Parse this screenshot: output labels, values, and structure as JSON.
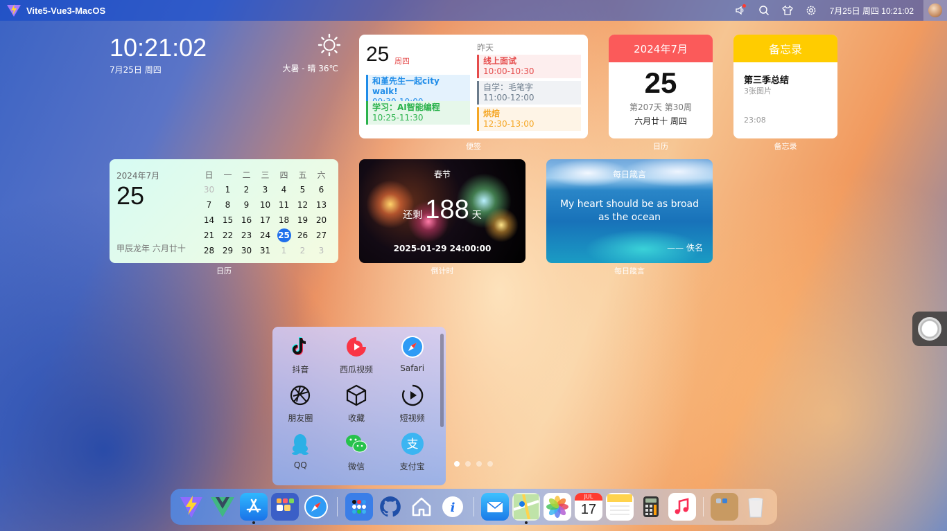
{
  "menubar": {
    "app_title": "Vite5-Vue3-MacOS",
    "datetime": "7月25日 周四 10:21:02",
    "icons": [
      "speaker-icon",
      "search-icon",
      "shirt-icon",
      "settings-icon",
      "avatar"
    ]
  },
  "clock": {
    "time": "10:21:02",
    "date": "7月25日 周四",
    "weather": "大暑 - 晴 36℃"
  },
  "notes": {
    "day": "25",
    "weekday": "周四",
    "yesterday_label": "昨天",
    "today_events": [
      {
        "title": "和堇先生一起city walk!",
        "time": "09:30-10:00",
        "color": "#1f8ce8"
      },
      {
        "title": "学习：AI智能编程",
        "time": "10:25-11:30",
        "color": "#2bb24c"
      }
    ],
    "yesterday_events": [
      {
        "title": "线上面试",
        "time": "10:00-10:30",
        "color": "#e54b4b"
      },
      {
        "title": "自学：毛笔字",
        "time": "11:00-12:00",
        "color": "#6b7b8b"
      },
      {
        "title": "烘焙",
        "time": "12:30-13:00",
        "color": "#f5a623"
      }
    ],
    "caption": "便签"
  },
  "calendar_card": {
    "header": "2024年7月",
    "day": "25",
    "sub": "第207天 第30周",
    "lunar": "六月廿十 周四",
    "caption": "日历"
  },
  "memo": {
    "header": "备忘录",
    "title": "第三季总结",
    "sub": "3张图片",
    "time": "23:08",
    "caption": "备忘录"
  },
  "month_calendar": {
    "year_month": "2024年7月",
    "day": "25",
    "lunar": "甲辰龙年 六月廿十",
    "weekdays": [
      "日",
      "一",
      "二",
      "三",
      "四",
      "五",
      "六"
    ],
    "days": [
      "30",
      "1",
      "2",
      "3",
      "4",
      "5",
      "6",
      "7",
      "8",
      "9",
      "10",
      "11",
      "12",
      "13",
      "14",
      "15",
      "16",
      "17",
      "18",
      "19",
      "20",
      "21",
      "22",
      "23",
      "24",
      "25",
      "26",
      "27",
      "28",
      "29",
      "30",
      "31",
      "1",
      "2",
      "3"
    ],
    "dim_indices": [
      0,
      32,
      33,
      34
    ],
    "today_index": 25,
    "caption": "日历"
  },
  "countdown": {
    "title": "春节",
    "remain_label": "还剩",
    "days": "188",
    "unit": "天",
    "target": "2025-01-29 24:00:00",
    "caption": "倒计时"
  },
  "quote": {
    "title": "每日箴言",
    "text": "My heart should be as broad as the ocean",
    "author": "—— 佚名",
    "caption": "每日箴言"
  },
  "folder": {
    "apps": [
      {
        "label": "抖音",
        "icon": "douyin-icon"
      },
      {
        "label": "西瓜视频",
        "icon": "xigua-icon"
      },
      {
        "label": "Safari",
        "icon": "safari-icon"
      },
      {
        "label": "朋友圈",
        "icon": "moments-icon"
      },
      {
        "label": "收藏",
        "icon": "cube-icon"
      },
      {
        "label": "短视频",
        "icon": "play-circle-icon"
      },
      {
        "label": "QQ",
        "icon": "qq-icon"
      },
      {
        "label": "微信",
        "icon": "wechat-icon"
      },
      {
        "label": "支付宝",
        "icon": "alipay-icon"
      }
    ],
    "page_count": 4,
    "active_page": 1
  },
  "dock": {
    "items": [
      "vite-icon",
      "vue-icon",
      "app-store-icon",
      "launchpad-icon",
      "safari-icon",
      "app-folder-icon",
      "github-icon",
      "home-icon",
      "info-icon",
      "mail-icon",
      "maps-icon",
      "photos-icon",
      "calendar-icon",
      "notes-icon",
      "calculator-icon",
      "music-icon",
      "finder-folder-icon",
      "trash-icon"
    ],
    "calendar_month": "JUL",
    "calendar_day": "17"
  },
  "colors": {
    "menubar": "#0f46c8",
    "accent_blue": "#1f6feb",
    "calendar_red": "#fb5a5a",
    "memo_yellow": "#ffcc00"
  }
}
